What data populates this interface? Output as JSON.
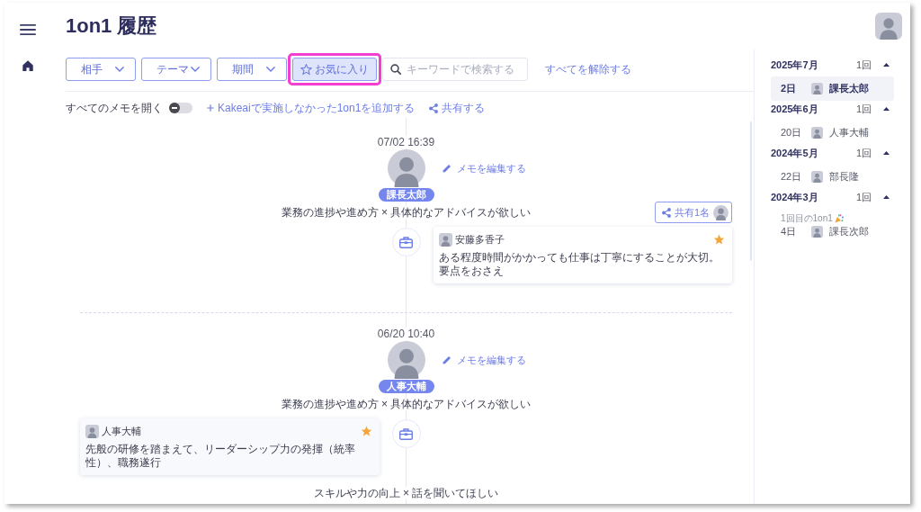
{
  "header": {
    "title": "1on1 履歴"
  },
  "filters": [
    {
      "kind": "dropdown",
      "label": "相手",
      "selected": false,
      "highlighted": false
    },
    {
      "kind": "dropdown",
      "label": "テーマ",
      "selected": false,
      "highlighted": false
    },
    {
      "kind": "dropdown",
      "label": "期間",
      "selected": false,
      "highlighted": false
    },
    {
      "kind": "favorite",
      "label": "お気に入り",
      "selected": true,
      "highlighted": true
    }
  ],
  "search": {
    "placeholder": "キーワードで検索する"
  },
  "clear_link": {
    "label": "すべてを解除する"
  },
  "memo_switch": {
    "label": "すべてのメモを開く",
    "on": false
  },
  "actions": [
    {
      "kind": "add",
      "label": "Kakeaiで実施しなかった1on1を追加する"
    },
    {
      "kind": "share",
      "label": "共有する"
    }
  ],
  "sessions": [
    {
      "datetime": "07/02 16:39",
      "partner": "課長太郎",
      "edit_link": "メモを編集する",
      "themes": [
        {
          "topic": "業務の進捗や進め方 × 具体的なアドバイスが欲しい",
          "share": {
            "label": "共有1名"
          },
          "memo": {
            "author": "安藤多香子",
            "starred": true,
            "text": "ある程度時間がかかっても仕事は丁寧にすることが大切。要点をおさえ"
          }
        }
      ]
    },
    {
      "datetime": "06/20 10:40",
      "partner": "人事大輔",
      "edit_link": "メモを編集する",
      "themes": [
        {
          "topic": "業務の進捗や進め方 × 具体的なアドバイスが欲しい",
          "memo": {
            "author": "人事大輔",
            "starred": true,
            "text": "先般の研修を踏まえて、リーダーシップ力の発揮（統率性）、職務遂行"
          }
        },
        {
          "topic": "スキルや力の向上 × 話を聞いてほしい"
        }
      ]
    }
  ],
  "history": [
    {
      "month": "2025年7月",
      "count": "1回",
      "expanded": true,
      "days": [
        {
          "day": "2日",
          "name": "課長太郎",
          "selected": true
        }
      ]
    },
    {
      "month": "2025年6月",
      "count": "1回",
      "expanded": true,
      "days": [
        {
          "day": "20日",
          "name": "人事大輔",
          "selected": false
        }
      ]
    },
    {
      "month": "2024年5月",
      "count": "1回",
      "expanded": true,
      "days": [
        {
          "day": "22日",
          "name": "部長隆",
          "selected": false
        }
      ]
    },
    {
      "month": "2024年3月",
      "count": "1回",
      "expanded": true,
      "days": [
        {
          "note": "1回目の1on1",
          "day": "4日",
          "name": "課長次郎",
          "selected": false
        }
      ]
    }
  ]
}
